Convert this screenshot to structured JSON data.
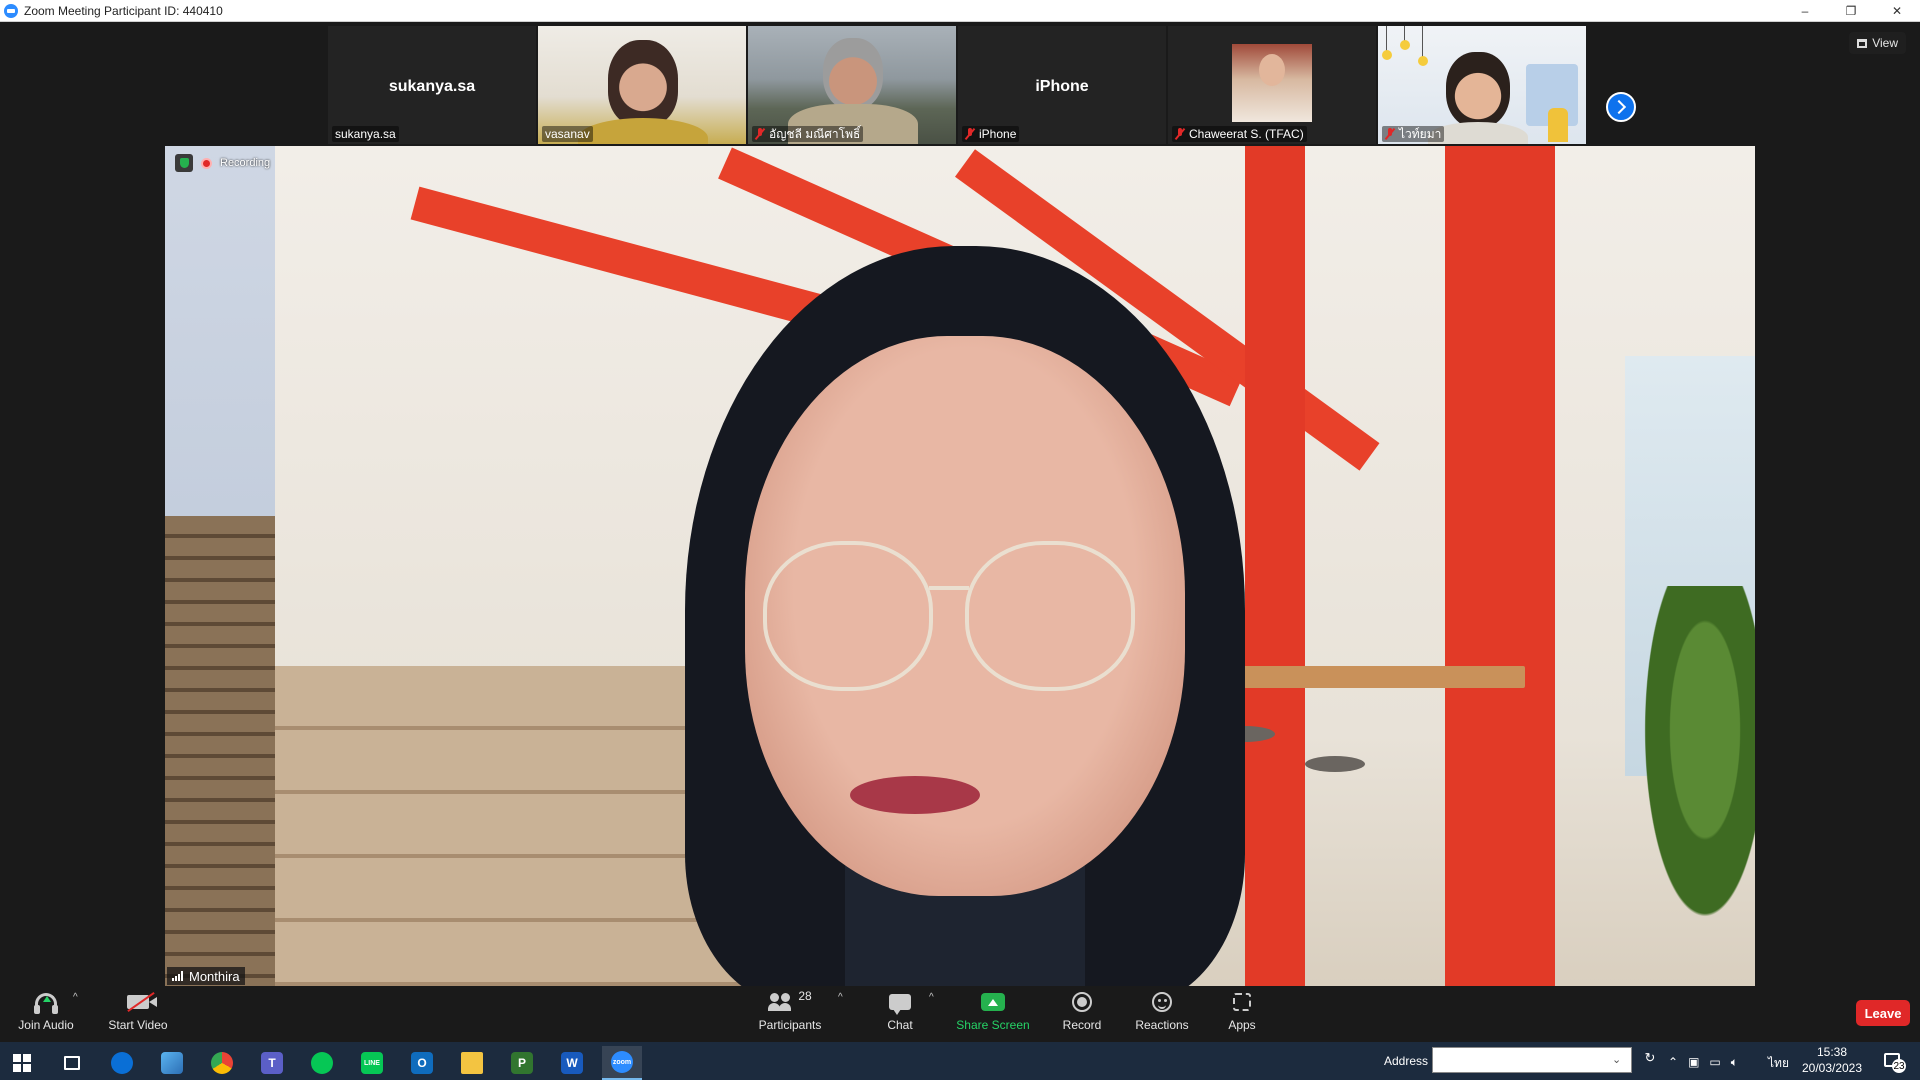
{
  "window": {
    "title": "Zoom Meeting Participant ID: 440410",
    "controls": {
      "minimize": "–",
      "restore": "❐",
      "close": "✕"
    }
  },
  "view_button": {
    "label": "View",
    "icon": "grid-icon"
  },
  "thumbnails": [
    {
      "name": "sukanya.sa",
      "center_name": "sukanya.sa",
      "muted": false,
      "video": false
    },
    {
      "name": "vasanav",
      "center_name": "",
      "muted": false,
      "video": true
    },
    {
      "name": "อัญชลี มณีศาโพธิ์",
      "center_name": "",
      "muted": true,
      "video": true
    },
    {
      "name": "iPhone",
      "center_name": "iPhone",
      "muted": true,
      "video": false
    },
    {
      "name": "Chaweerat S. (TFAC)",
      "center_name": "",
      "muted": true,
      "video": true
    },
    {
      "name": "ไวท์ยมา",
      "center_name": "",
      "muted": true,
      "video": true
    }
  ],
  "main_video": {
    "speaker": "Monthira",
    "recording_text": "Recording"
  },
  "toolbar": {
    "join_audio": "Join Audio",
    "start_video": "Start Video",
    "participants": "Participants",
    "participant_count": "28",
    "chat": "Chat",
    "share_screen": "Share Screen",
    "record": "Record",
    "reactions": "Reactions",
    "apps": "Apps",
    "leave": "Leave",
    "share_color": "#25b14e",
    "leave_color": "#e02828"
  },
  "taskbar": {
    "address_label": "Address",
    "address_value": "",
    "language": "ไทย",
    "time": "15:38",
    "date": "20/03/2023",
    "notification_count": "23",
    "apps": [
      {
        "name": "start",
        "label": ""
      },
      {
        "name": "task-view",
        "label": ""
      },
      {
        "name": "dell",
        "label": ""
      },
      {
        "name": "file-transfer",
        "label": ""
      },
      {
        "name": "chrome",
        "label": ""
      },
      {
        "name": "teams",
        "label": "T"
      },
      {
        "name": "line-notify",
        "label": ""
      },
      {
        "name": "line",
        "label": "LINE"
      },
      {
        "name": "outlook",
        "label": "O"
      },
      {
        "name": "file-explorer",
        "label": ""
      },
      {
        "name": "project",
        "label": "P"
      },
      {
        "name": "word",
        "label": "W"
      },
      {
        "name": "zoom",
        "label": "zoom"
      }
    ]
  }
}
